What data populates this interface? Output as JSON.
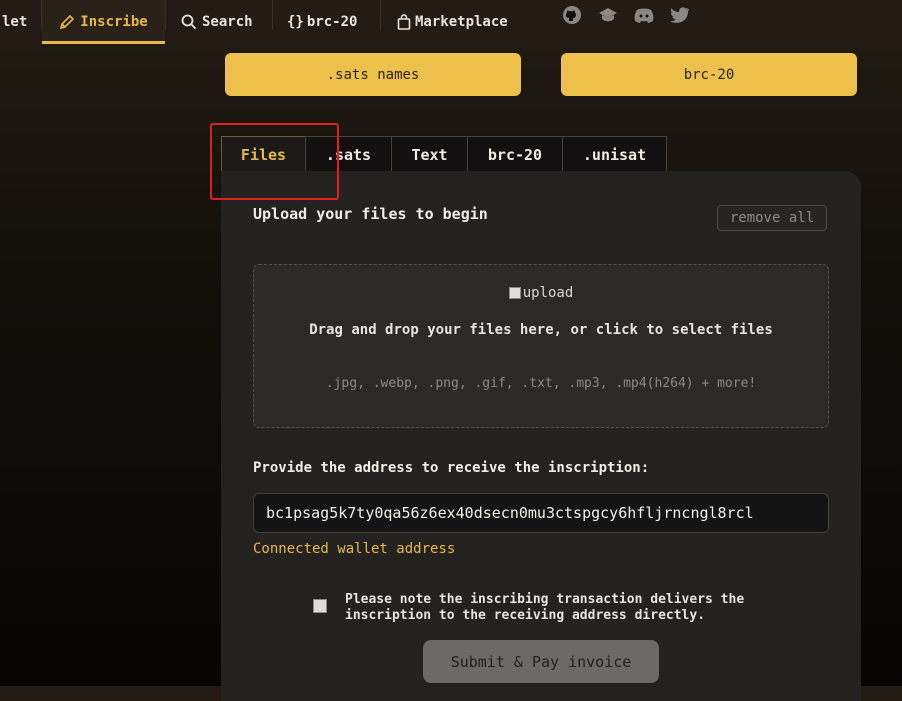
{
  "nav": {
    "wallet_label": "let",
    "inscribe_label": "Inscribe",
    "search_label": "Search",
    "brc20_label": "brc-20",
    "brc20_prefix": "{}",
    "marketplace_label": "Marketplace"
  },
  "social": [
    "github-icon",
    "docs-icon",
    "discord-icon",
    "twitter-icon"
  ],
  "top_buttons": {
    "sats_names": ".sats names",
    "brc20": "brc-20"
  },
  "tabs": [
    {
      "label": "Files",
      "active": true
    },
    {
      "label": ".sats"
    },
    {
      "label": "Text"
    },
    {
      "label": "brc-20"
    },
    {
      "label": ".unisat"
    }
  ],
  "panel": {
    "title": "Upload your files to begin",
    "remove_all": "remove all",
    "dropzone": {
      "image_alt": "upload",
      "instruction": "Drag and drop your files here, or click to select files",
      "extensions": ".jpg, .webp, .png, .gif, .txt, .mp3, .mp4(h264) + more!"
    },
    "address_label": "Provide the address to receive the inscription:",
    "address_value": "bc1psag5k7ty0qa56z6ex40dsecn0mu3ctspgcy6hfljrncngl8rcl",
    "connected_label": "Connected wallet address",
    "note": "Please note the inscribing transaction delivers the inscription to the receiving address directly.",
    "submit_label": "Submit & Pay invoice"
  },
  "colors": {
    "accent": "#e9b949",
    "button": "#ecc04b",
    "panel": "#232221",
    "highlight": "#e21d1d"
  }
}
